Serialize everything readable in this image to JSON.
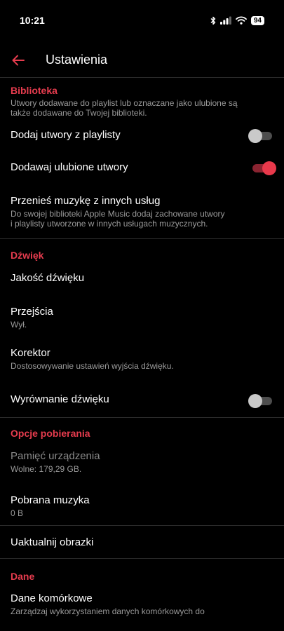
{
  "status_bar": {
    "time": "10:21",
    "battery": "94",
    "icons": [
      "bluetooth-icon",
      "signal-icon",
      "wifi-icon",
      "battery-icon"
    ]
  },
  "header": {
    "title": "Ustawienia",
    "back_icon": "back-arrow-icon"
  },
  "colors": {
    "accent": "#e63c4e",
    "background": "#000000",
    "secondary_text": "#9a9a9a"
  },
  "library": {
    "header": "Biblioteka",
    "description_line1": "Utwory dodawane do playlist lub oznaczane jako ulubione są",
    "description_line2": "także dodawane do Twojej biblioteki.",
    "add_from_playlists": {
      "label": "Dodaj utwory z playlisty",
      "enabled": false
    },
    "add_favorites": {
      "label": "Dodawaj ulubione utwory",
      "enabled": true
    },
    "transfer": {
      "label": "Przenieś muzykę z innych usług",
      "desc_line1": "Do swojej biblioteki Apple Music dodaj zachowane utwory",
      "desc_line2": "i playlisty utworzone w innych usługach muzycznych."
    }
  },
  "sound": {
    "header": "Dźwięk",
    "quality": {
      "label": "Jakość dźwięku"
    },
    "crossfade": {
      "label": "Przejścia",
      "value": "Wył."
    },
    "equalizer": {
      "label": "Korektor",
      "desc": "Dostosowywanie ustawień wyjścia dźwięku."
    },
    "normalization": {
      "label": "Wyrównanie dźwięku",
      "enabled": false
    }
  },
  "downloads": {
    "header": "Opcje pobierania",
    "storage": {
      "label": "Pamięć urządzenia",
      "value": "Wolne: 179,29 GB."
    },
    "downloaded": {
      "label": "Pobrana muzyka",
      "value": "0 B"
    },
    "update_artwork": {
      "label": "Uaktualnij obrazki"
    }
  },
  "data": {
    "header": "Dane",
    "cellular": {
      "label": "Dane komórkowe",
      "desc": "Zarządzaj wykorzystaniem danych komórkowych do"
    }
  }
}
